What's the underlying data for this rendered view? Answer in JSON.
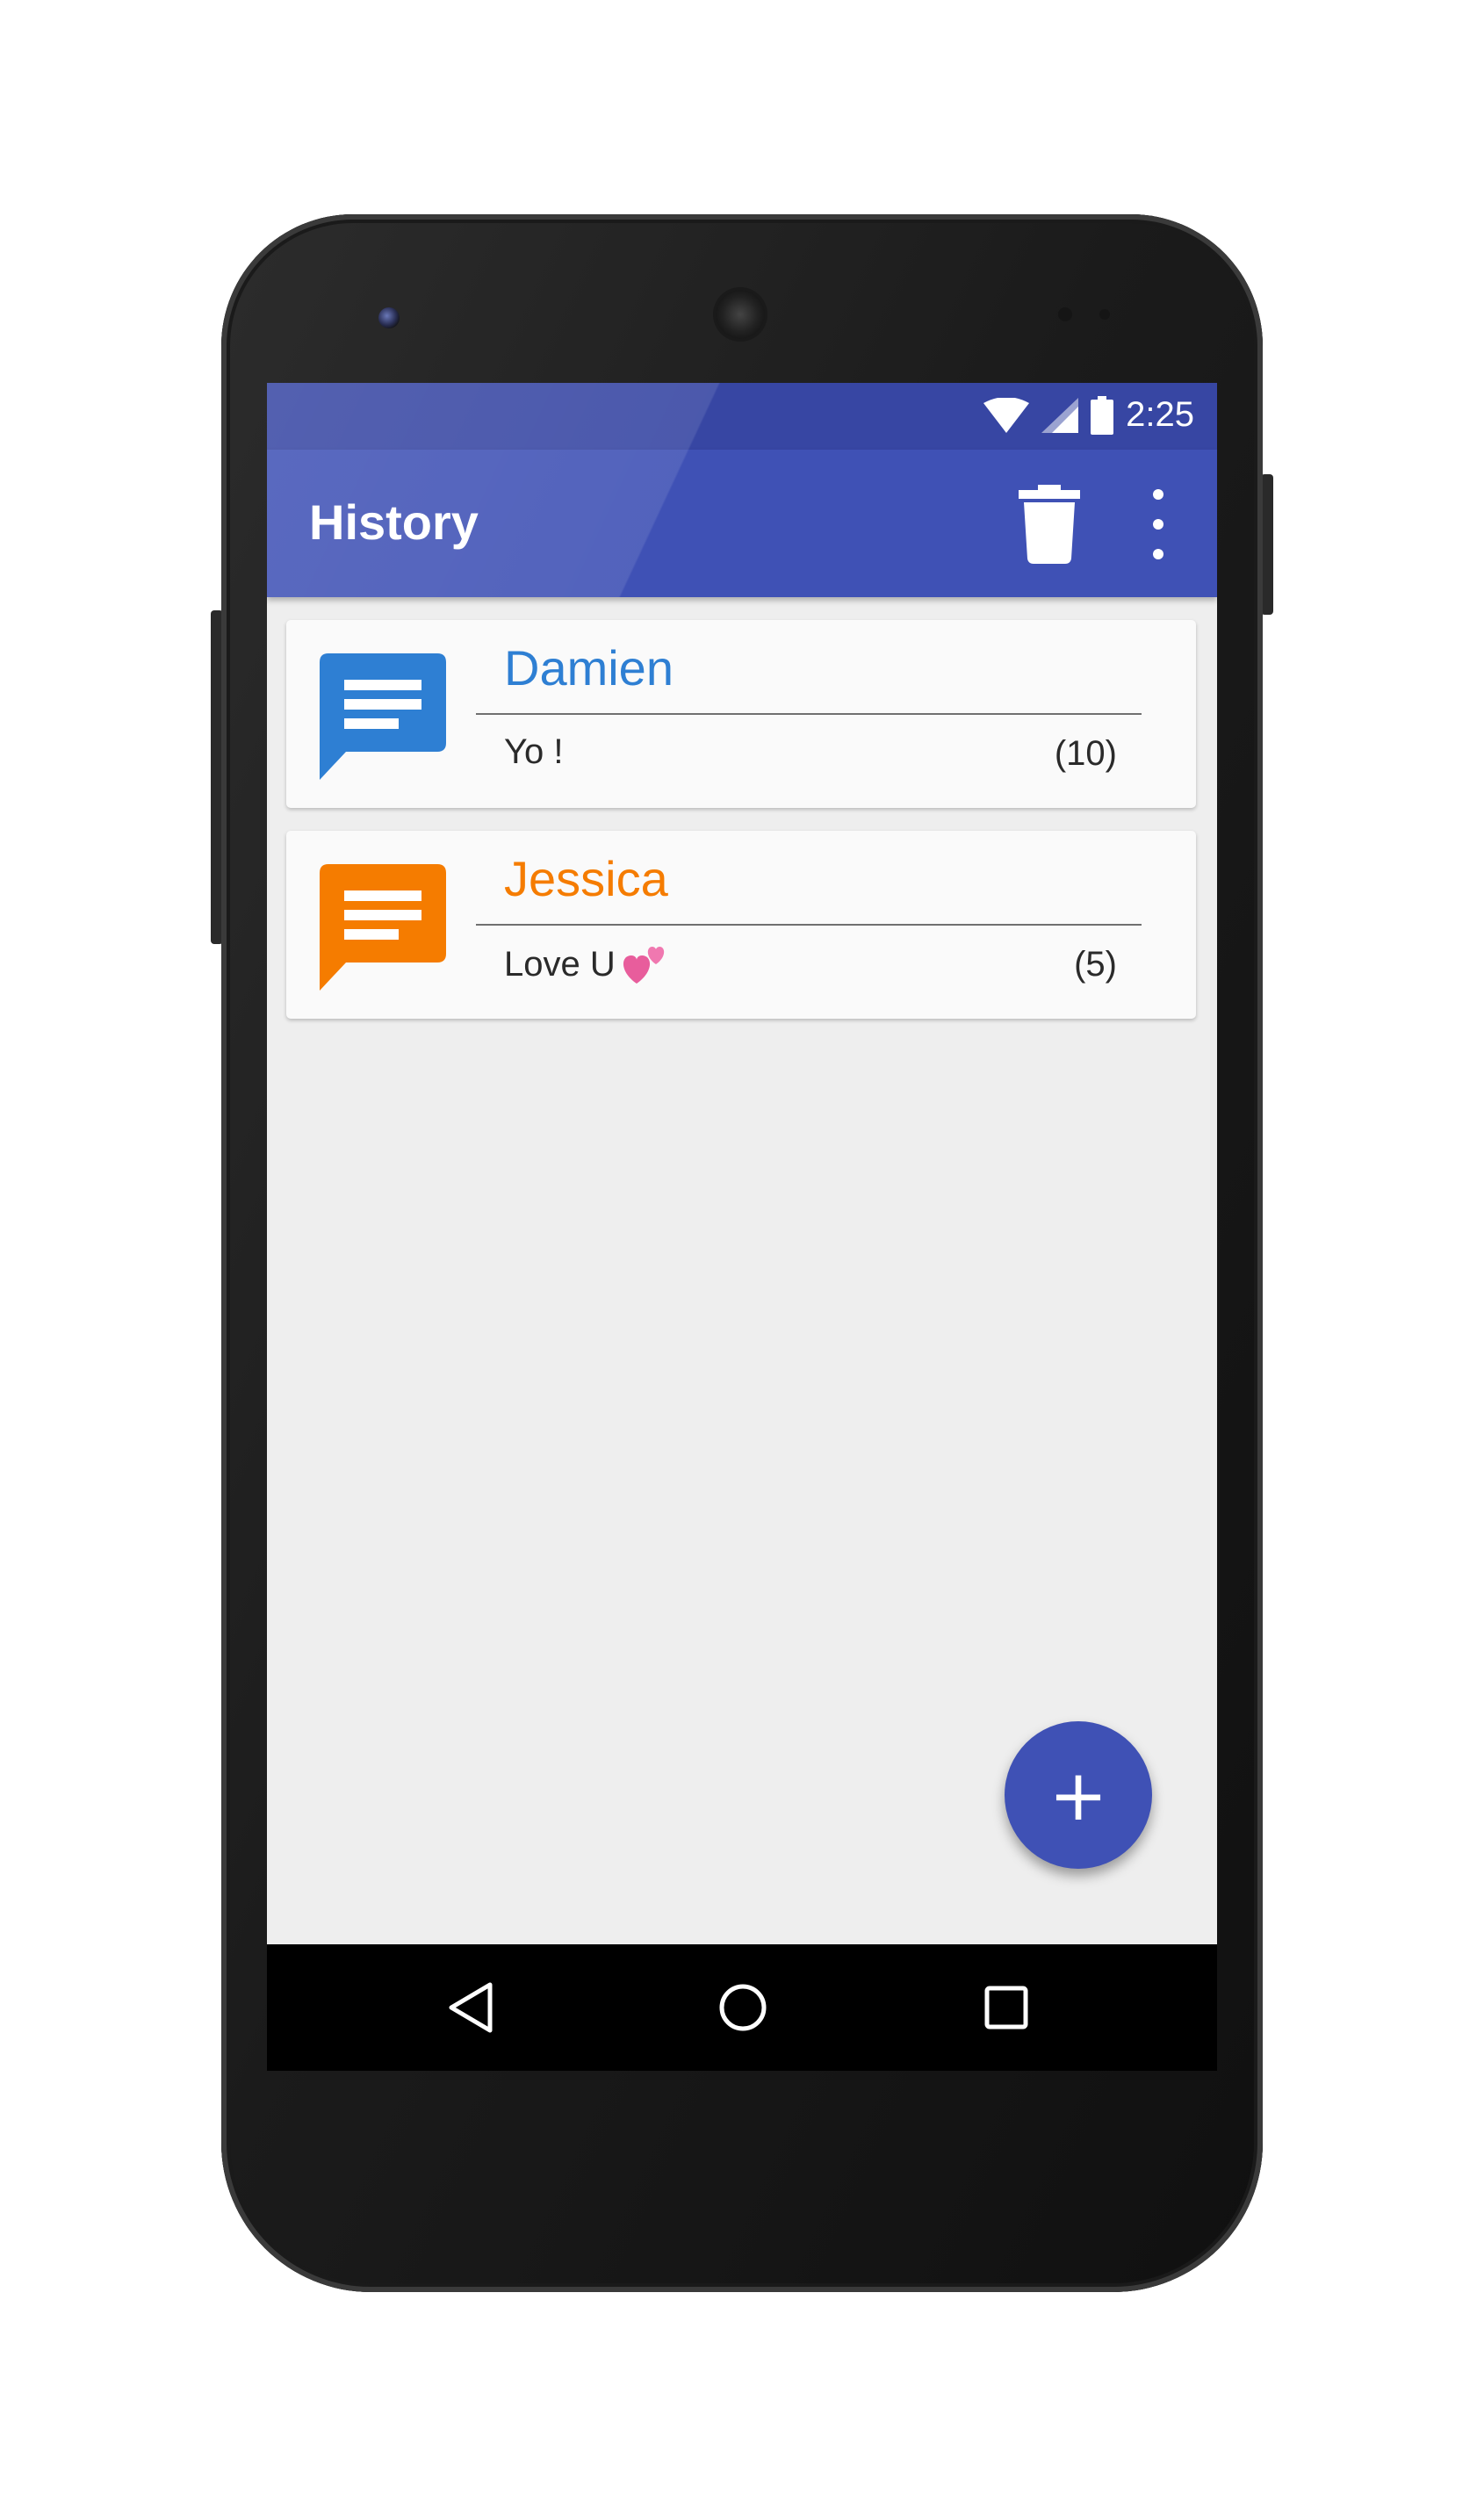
{
  "statusbar": {
    "time": "2:25",
    "icons": [
      "wifi-icon",
      "cell-signal-icon",
      "battery-icon"
    ]
  },
  "appbar": {
    "title": "History",
    "actions": [
      "delete-icon",
      "more-vert-icon"
    ]
  },
  "conversations": [
    {
      "name": "Damien",
      "preview": "Yo !",
      "count": "(10)",
      "color": "#2e7fd3",
      "icon": "message-icon"
    },
    {
      "name": "Jessica",
      "preview": "Love U",
      "count": "(5)",
      "color": "#f57c00",
      "icon": "message-icon",
      "emoji": "two-hearts-icon"
    }
  ],
  "fab": {
    "label": "+",
    "icon": "add-icon"
  },
  "navbar": {
    "buttons": [
      "back-icon",
      "home-icon",
      "recents-icon"
    ]
  },
  "colors": {
    "primary": "#3f51b5",
    "primary_dark": "#3746a3",
    "background": "#eeeeee"
  }
}
